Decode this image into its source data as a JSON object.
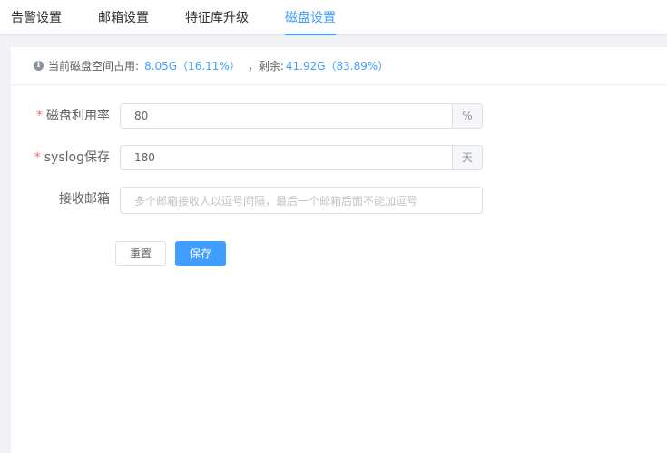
{
  "tabs": [
    {
      "label": "告警设置"
    },
    {
      "label": "邮箱设置"
    },
    {
      "label": "特征库升级"
    },
    {
      "label": "磁盘设置"
    }
  ],
  "disk_info": {
    "prefix": "当前磁盘空间占用:",
    "used": "8.05G（16.11%）",
    "separator": "，剩余:",
    "free": "41.92G（83.89%）"
  },
  "form": {
    "usage": {
      "required_mark": "*",
      "label": "磁盘利用率",
      "value": "80",
      "unit": "%"
    },
    "syslog": {
      "required_mark": "*",
      "label": "syslog保存",
      "value": "180",
      "unit": "天"
    },
    "email": {
      "label": "接收邮箱",
      "placeholder": "多个邮箱接收人以逗号间隔，最后一个邮箱后面不能加逗号"
    }
  },
  "buttons": {
    "reset": "重置",
    "save": "保存"
  },
  "colors": {
    "accent": "#409eff",
    "required": "#f56c6c"
  }
}
